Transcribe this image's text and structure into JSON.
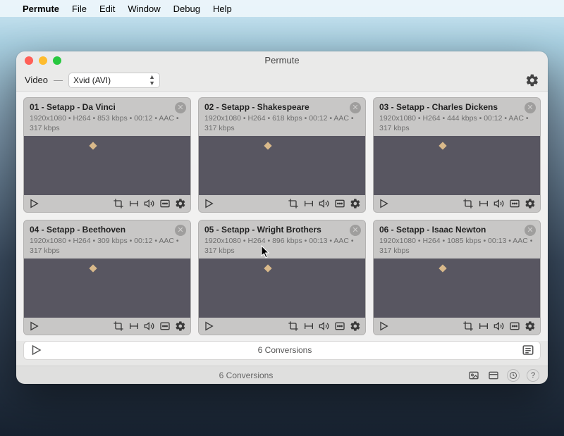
{
  "menubar": {
    "app": "Permute",
    "items": [
      "File",
      "Edit",
      "Window",
      "Debug",
      "Help"
    ]
  },
  "window": {
    "title": "Permute"
  },
  "toolbar": {
    "category": "Video",
    "preset": "Xvid (AVI)"
  },
  "cards": [
    {
      "title": "01 - Setapp - Da Vinci",
      "meta": "1920x1080 • H264 • 853 kbps • 00:12 • AAC • 317 kbps"
    },
    {
      "title": "02 - Setapp - Shakespeare",
      "meta": "1920x1080 • H264 • 618 kbps • 00:12 • AAC • 317 kbps"
    },
    {
      "title": "03 - Setapp - Charles Dickens",
      "meta": "1920x1080 • H264 • 444 kbps • 00:12 • AAC • 317 kbps"
    },
    {
      "title": "04 - Setapp - Beethoven",
      "meta": "1920x1080 • H264 • 309 kbps • 00:12 • AAC • 317 kbps"
    },
    {
      "title": "05 - Setapp - Wright Brothers",
      "meta": "1920x1080 • H264 • 896 kbps • 00:13 • AAC • 317 kbps"
    },
    {
      "title": "06 - Setapp - Isaac Newton",
      "meta": "1920x1080 • H264 • 1085 kbps • 00:13 • AAC • 317 kbps"
    }
  ],
  "summary": {
    "label": "6 Conversions"
  },
  "status": {
    "label": "6 Conversions"
  }
}
